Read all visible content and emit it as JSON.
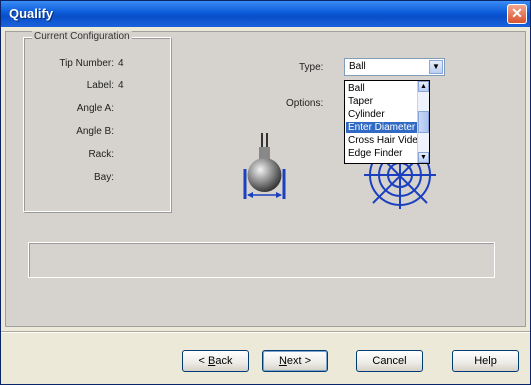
{
  "window": {
    "title": "Qualify",
    "close_glyph": "✕"
  },
  "config": {
    "legend": "Current Configuration",
    "rows": [
      {
        "label": "Tip Number:",
        "value": "4"
      },
      {
        "label": "Label:",
        "value": "4"
      },
      {
        "label": "Angle A:",
        "value": ""
      },
      {
        "label": "Angle B:",
        "value": ""
      },
      {
        "label": "Rack:",
        "value": ""
      },
      {
        "label": "Bay:",
        "value": ""
      }
    ]
  },
  "type_field": {
    "label": "Type:",
    "selected": "Ball",
    "arrow": "▼"
  },
  "options_label": "Options:",
  "dropdown": {
    "items": [
      "Ball",
      "Taper",
      "Cylinder",
      "Enter Diameter",
      "Cross Hair Video",
      "Edge Finder"
    ],
    "highlighted_index": 3,
    "scroll_up": "▲",
    "scroll_down": "▼"
  },
  "buttons": {
    "back": {
      "prefix": "< ",
      "accel": "B",
      "rest": "ack"
    },
    "next": {
      "accel": "N",
      "rest": "ext >"
    },
    "cancel": "Cancel",
    "help": "Help"
  },
  "colors": {
    "title_bar": "#0b5ad8",
    "selection": "#316ac5",
    "diagram_blue": "#1a3fbf"
  }
}
